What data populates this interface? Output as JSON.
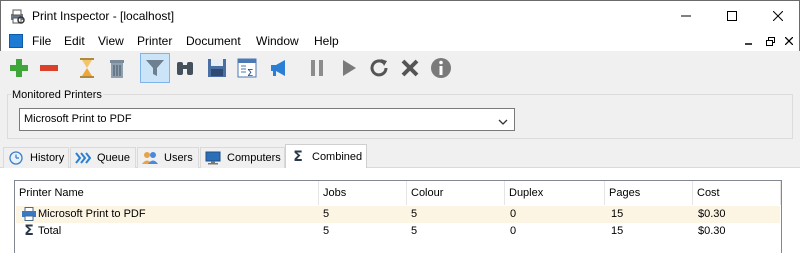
{
  "window": {
    "title": "Print Inspector - [localhost]"
  },
  "menu": {
    "items": [
      "File",
      "Edit",
      "View",
      "Printer",
      "Document",
      "Window",
      "Help"
    ]
  },
  "toolbar": {
    "buttons": [
      "add-icon",
      "remove-icon",
      "hourglass-icon",
      "trash-icon",
      "filter-icon",
      "binoculars-icon",
      "save-icon",
      "report-icon",
      "megaphone-icon",
      "pause-icon",
      "play-icon",
      "refresh-icon",
      "cancel-icon",
      "info-icon"
    ],
    "active": "filter-icon"
  },
  "monitored": {
    "legend": "Monitored Printers",
    "selected": "Microsoft Print to PDF"
  },
  "tabs": [
    {
      "label": "History",
      "icon": "clock-icon"
    },
    {
      "label": "Queue",
      "icon": "queue-icon"
    },
    {
      "label": "Users",
      "icon": "users-icon"
    },
    {
      "label": "Computers",
      "icon": "computers-icon"
    },
    {
      "label": "Combined",
      "icon": "sigma-icon",
      "selected": true
    }
  ],
  "table": {
    "columns": [
      "Printer Name",
      "Jobs",
      "Colour",
      "Duplex",
      "Pages",
      "Cost"
    ],
    "rows": [
      {
        "icon": "printer-icon",
        "cells": [
          "Microsoft Print to PDF",
          "5",
          "5",
          "0",
          "15",
          "$0.30"
        ]
      },
      {
        "icon": "sigma-icon",
        "cells": [
          "Total",
          "5",
          "5",
          "0",
          "15",
          "$0.30"
        ]
      }
    ]
  },
  "colors": {
    "accent": "#1e7bd4",
    "row_highlight": "#fcf5e3",
    "active_button": "#cce4f7"
  }
}
